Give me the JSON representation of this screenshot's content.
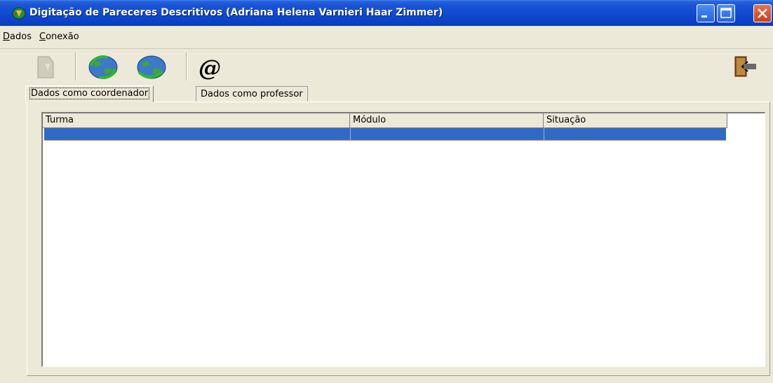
{
  "window": {
    "title": "Digitação de Pareceres Descritivos (Adriana Helena Varnieri Haar Zimmer)"
  },
  "menu": {
    "items": [
      {
        "accel": "D",
        "rest": "ados"
      },
      {
        "accel": "C",
        "rest": "onexão"
      }
    ]
  },
  "toolbar": {
    "icons": [
      "document-icon",
      "globe-refresh-icon",
      "globe-send-icon",
      "at-sign-icon",
      "exit-door-icon"
    ]
  },
  "tabs": [
    {
      "label": "Dados como coordenador",
      "active": true
    },
    {
      "label": "Dados como professor",
      "active": false
    }
  ],
  "table": {
    "columns": [
      "Turma",
      "Módulo",
      "Situação"
    ],
    "rows": [
      [
        "",
        "",
        ""
      ]
    ]
  },
  "colors": {
    "titlebar": "#0a47cf",
    "selection": "#316ac5",
    "face": "#ece9d8"
  }
}
